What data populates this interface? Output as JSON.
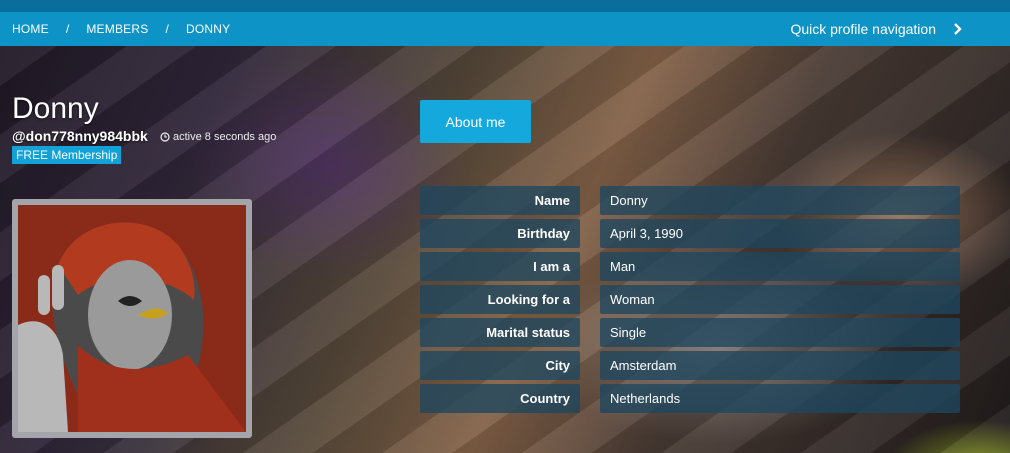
{
  "breadcrumb": [
    "HOME",
    "MEMBERS",
    "DONNY"
  ],
  "breadcrumb_separator": "/",
  "quick_nav": {
    "label": "Quick profile navigation",
    "icon": "chevron-right-icon"
  },
  "profile": {
    "display_name": "Donny",
    "username": "@don778nny984bbk",
    "activity": "active 8 seconds ago",
    "membership": "FREE Membership"
  },
  "about_button": "About me",
  "details": [
    {
      "label": "Name",
      "value": "Donny"
    },
    {
      "label": "Birthday",
      "value": "April 3, 1990"
    },
    {
      "label": "I am a",
      "value": "Man"
    },
    {
      "label": "Looking for a",
      "value": "Woman"
    },
    {
      "label": "Marital status",
      "value": "Single"
    },
    {
      "label": "City",
      "value": "Amsterdam"
    },
    {
      "label": "Country",
      "value": "Netherlands"
    }
  ],
  "colors": {
    "nav": "#0d93c6",
    "accent": "#14a8dc",
    "topstrip": "#0a6e9c"
  }
}
